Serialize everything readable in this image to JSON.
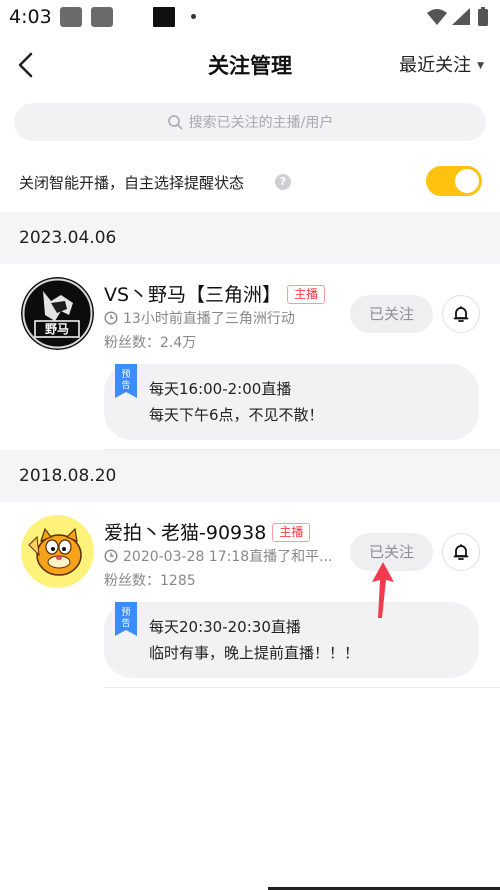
{
  "status_bar": {
    "time": "4:03"
  },
  "header": {
    "title": "关注管理",
    "sort_label": "最近关注"
  },
  "search": {
    "placeholder": "搜索已关注的主播/用户"
  },
  "smart": {
    "label": "关闭智能开播，自主选择提醒状态",
    "toggle_on": true,
    "toggle_color": "#ffc20e"
  },
  "groups": [
    {
      "date": "2023.04.06",
      "user": {
        "name": "VS丶野马【三角洲】",
        "tag": "主播",
        "live_text": "13小时前直播了三角洲行动",
        "fans": "粉丝数：2.4万",
        "avatar_text": "野马",
        "follow_label": "已关注",
        "notice_badge": "预告",
        "notice_line1": "每天16:00-2:00直播",
        "notice_line2": "每天下午6点，不见不散！"
      }
    },
    {
      "date": "2018.08.20",
      "user": {
        "name": "爱拍丶老猫-90938",
        "tag": "主播",
        "live_text": "2020-03-28 17:18直播了和平...",
        "fans": "粉丝数：1285",
        "follow_label": "已关注",
        "notice_badge": "预告",
        "notice_line1": "每天20:30-20:30直播",
        "notice_line2": "临时有事，晚上提前直播！！！"
      }
    }
  ],
  "colors": {
    "accent": "#ffc20e",
    "tag_red": "#ff3b4a",
    "badge_blue": "#3b8cff",
    "arrow_red": "#f23b4c"
  }
}
